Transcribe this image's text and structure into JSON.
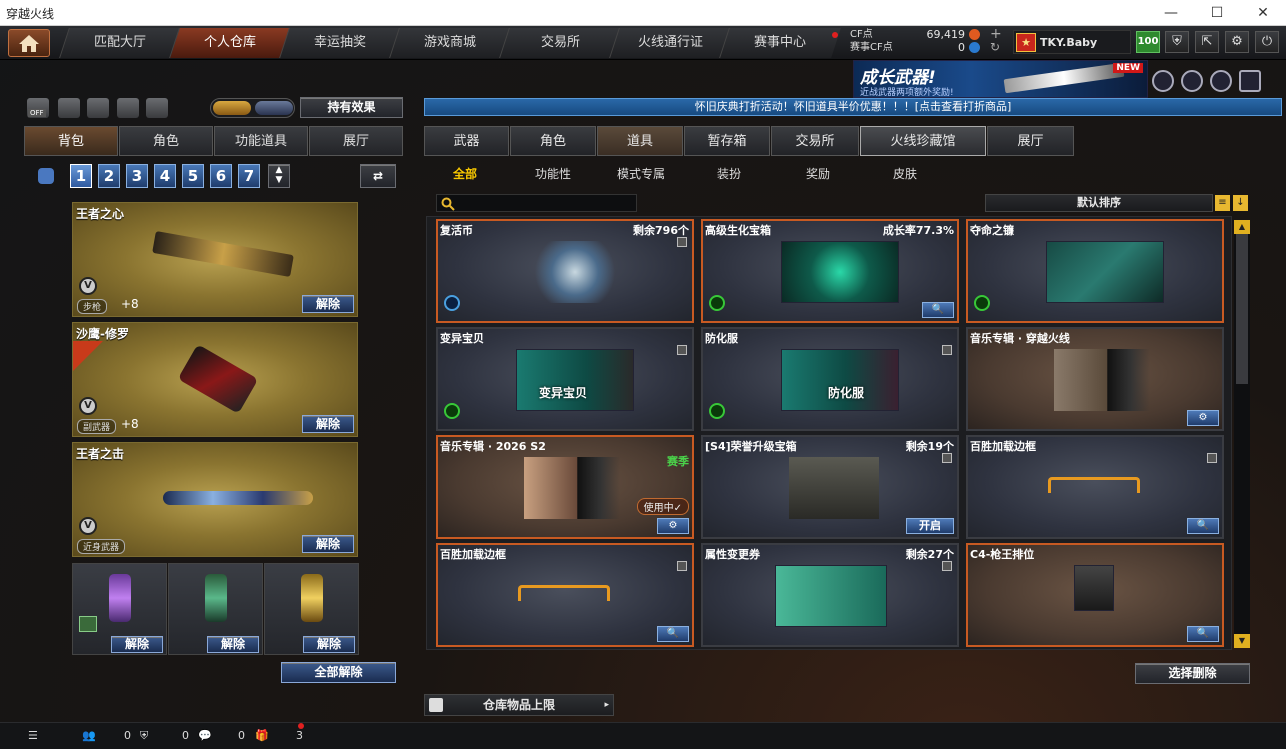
{
  "window": {
    "title": "穿越火线",
    "controls": [
      "—",
      "☐",
      "✕"
    ]
  },
  "nav": {
    "tabs": [
      "匹配大厅",
      "个人仓库",
      "幸运抽奖",
      "游戏商城",
      "交易所",
      "火线通行证",
      "赛事中心"
    ],
    "active": "个人仓库"
  },
  "currency": {
    "cf_label": "CF点",
    "cf_value": "69,419",
    "event_cf_label": "赛事CF点",
    "event_cf_value": "0"
  },
  "user": {
    "rank_icon": "rank-badge",
    "name": "TKY.Baby",
    "level": "100"
  },
  "banner": {
    "title": "成长武器!",
    "subtitle": "近战武器两项额外奖励!",
    "badge": "NEW"
  },
  "left": {
    "effects_button": "持有效果",
    "toggle_off": "OFF",
    "tabs": [
      "背包",
      "角色",
      "功能道具",
      "展厅"
    ],
    "active_tab": "背包",
    "bag_numbers": [
      "1",
      "2",
      "3",
      "4",
      "5",
      "6",
      "7"
    ],
    "active_bag": "1",
    "slots": [
      {
        "name": "王者之心",
        "class": "步枪",
        "plus": "+8",
        "unlock": "解除"
      },
      {
        "name": "沙鹰-修罗",
        "class": "副武器",
        "plus": "+8",
        "unlock": "解除"
      },
      {
        "name": "王者之击",
        "class": "近身武器",
        "plus": "",
        "unlock": "解除"
      }
    ],
    "grenades": [
      {
        "unlock": "解除",
        "color": "#a060d0"
      },
      {
        "unlock": "解除",
        "color": "#3a9a6a"
      },
      {
        "unlock": "解除",
        "color": "#d8b030"
      }
    ],
    "release_all": "全部解除"
  },
  "notice": "怀旧庆典打折活动！怀旧道具半价优惠！！！[点击查看打折商品]",
  "right": {
    "tabs": [
      "武器",
      "角色",
      "道具",
      "暂存箱",
      "交易所",
      "火线珍藏馆",
      "展厅"
    ],
    "active_tab": "道具",
    "categories": [
      "全部",
      "功能性",
      "模式专属",
      "装扮",
      "奖励",
      "皮肤"
    ],
    "active_category": "全部",
    "search_placeholder": "",
    "sort_label": "默认排序",
    "select_delete": "选择删除",
    "capacity_label": "仓库物品上限",
    "cards": [
      {
        "name": "复活币",
        "meta": "剩余796个",
        "img_color": "#3a5a7a",
        "style": "orange-blue",
        "action": ""
      },
      {
        "name": "高级生化宝箱",
        "meta": "成长率77.3%",
        "img_color": "#0e5a4a",
        "style": "orange-green",
        "action": "search"
      },
      {
        "name": "夺命之镰",
        "meta": "",
        "img_color": "#174a44",
        "style": "orange-green",
        "action": ""
      },
      {
        "name": "变异宝贝",
        "meta": "",
        "img_color": "#146a60",
        "style": "green",
        "action": "",
        "overlay": "变异宝贝"
      },
      {
        "name": "防化服",
        "meta": "",
        "img_color": "#146a60",
        "style": "green",
        "action": "",
        "overlay": "防化服"
      },
      {
        "name": "音乐专辑 · 穿越火线",
        "meta": "",
        "img_color": "#5a5048",
        "style": "brown",
        "action": "gear"
      },
      {
        "name": "音乐专辑 · 2026 S2",
        "meta": "",
        "season": "赛季",
        "in_use": "使用中✓",
        "img_color": "#6a4a3a",
        "style": "brown-orange",
        "action": "gear"
      },
      {
        "name": "[S4]荣誉升级宝箱",
        "meta": "剩余19个",
        "img_color": "#3a3a36",
        "style": "plain",
        "action": "开启"
      },
      {
        "name": "百胜加载边框",
        "meta": "",
        "img_color": "#2a2d36",
        "style": "plain",
        "action": "search"
      },
      {
        "name": "百胜加载边框",
        "meta": "",
        "img_color": "#2a2d36",
        "style": "orange",
        "action": "search"
      },
      {
        "name": "属性变更券",
        "meta": "剩余27个",
        "img_color": "#2a7a64",
        "style": "plain",
        "action": ""
      },
      {
        "name": "C4-枪王排位",
        "meta": "",
        "img_color": "#3a3230",
        "style": "brown-orange",
        "action": "search"
      }
    ]
  },
  "statusbar": {
    "count1": "0",
    "count2": "0",
    "count3": "0",
    "gift_count": "3"
  }
}
